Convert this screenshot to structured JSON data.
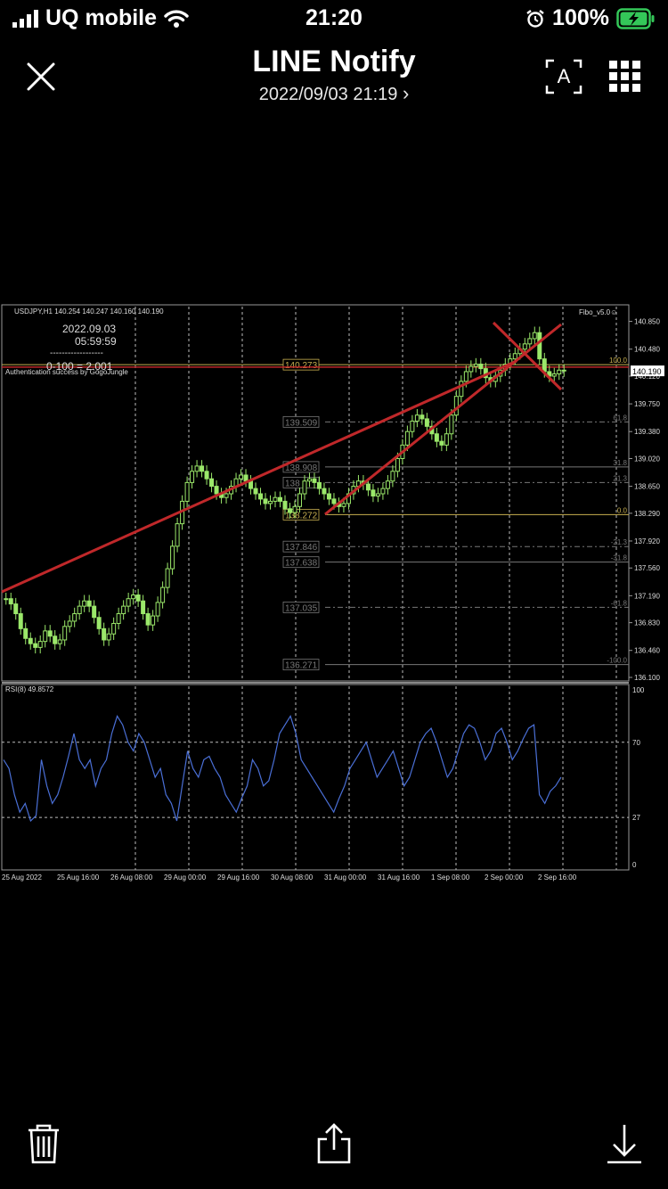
{
  "status_bar": {
    "carrier": "UQ mobile",
    "time": "21:20",
    "battery": "100%"
  },
  "header": {
    "title": "LINE Notify",
    "subtitle": "2022/09/03 21:19",
    "chevron": "›",
    "translate_label": "A"
  },
  "icons": {
    "close": "close-icon",
    "translate": "live-text-icon",
    "grid": "grid-icon",
    "delete": "trash-icon",
    "share": "share-icon",
    "save": "download-icon"
  },
  "chart_data": {
    "type": "line",
    "symbol_header": "USDJPY,H1  140.254 140.247 140.160 140.190",
    "indicator_name": "Fibo_v5.0☺",
    "overlay": {
      "date": "2022.09.03",
      "time": "05:59:59",
      "dashes": "------------------",
      "calc": "0-100 = 2.001",
      "auth": "Authentication success   by GogoJungle"
    },
    "ylim": [
      136.1,
      141.0
    ],
    "price_axis": [
      "140.850",
      "140.480",
      "140.120",
      "139.750",
      "139.380",
      "139.020",
      "138.650",
      "138.290",
      "137.920",
      "137.560",
      "137.190",
      "136.830",
      "136.460",
      "136.100"
    ],
    "price_axis_values": [
      140.85,
      140.48,
      140.12,
      139.75,
      139.38,
      139.02,
      138.65,
      138.29,
      137.92,
      137.56,
      137.19,
      136.83,
      136.46,
      136.1
    ],
    "current_price": "140.190",
    "fib_levels": [
      {
        "pct": "100.0",
        "price": "140.273",
        "value": 140.273,
        "color": "#c8b050"
      },
      {
        "pct": "61.8",
        "price": "139.509",
        "value": 139.509,
        "color": "#777"
      },
      {
        "pct": "31.8",
        "price": "138.908",
        "value": 138.908,
        "color": "#777"
      },
      {
        "pct": "21.3",
        "price": "138",
        "value": 138.7,
        "color": "#777"
      },
      {
        "pct": "0.0",
        "price": "138.272",
        "value": 138.272,
        "color": "#c8b050"
      },
      {
        "pct": "-21.3",
        "price": "137.846",
        "value": 137.846,
        "color": "#777"
      },
      {
        "pct": "-31.8",
        "price": "137.638",
        "value": 137.638,
        "color": "#777"
      },
      {
        "pct": "-61.8",
        "price": "137.035",
        "value": 137.035,
        "color": "#777"
      },
      {
        "pct": "-100.0",
        "price": "136.271",
        "value": 136.271,
        "color": "#777"
      }
    ],
    "close_series": [
      137.15,
      137.08,
      136.95,
      136.75,
      136.62,
      136.55,
      136.5,
      136.58,
      136.72,
      136.65,
      136.55,
      136.6,
      136.78,
      136.85,
      136.95,
      137.05,
      137.12,
      137.05,
      136.9,
      136.75,
      136.6,
      136.68,
      136.82,
      136.95,
      137.05,
      137.15,
      137.2,
      137.12,
      136.95,
      136.8,
      136.92,
      137.1,
      137.3,
      137.55,
      137.85,
      138.15,
      138.45,
      138.7,
      138.85,
      138.92,
      138.85,
      138.75,
      138.65,
      138.55,
      138.5,
      138.55,
      138.65,
      138.75,
      138.8,
      138.72,
      138.62,
      138.55,
      138.48,
      138.42,
      138.45,
      138.5,
      138.45,
      138.35,
      138.3,
      138.38,
      138.55,
      138.72,
      138.75,
      138.7,
      138.62,
      138.55,
      138.48,
      138.42,
      138.38,
      138.42,
      138.55,
      138.65,
      138.72,
      138.68,
      138.6,
      138.52,
      138.55,
      138.62,
      138.72,
      138.85,
      139.02,
      139.2,
      139.38,
      139.52,
      139.6,
      139.55,
      139.45,
      139.35,
      139.25,
      139.2,
      139.35,
      139.6,
      139.85,
      140.05,
      140.18,
      140.25,
      140.28,
      140.22,
      140.1,
      140.05,
      140.12,
      140.2,
      140.28,
      140.35,
      140.42,
      140.48,
      140.55,
      140.62,
      140.7,
      140.35,
      140.18,
      140.12,
      140.15,
      140.2,
      140.19
    ],
    "rsi_label": "RSI(8) 49.8572",
    "rsi_levels": [
      "100",
      "70",
      "27",
      "0"
    ],
    "rsi_values": [
      60,
      55,
      40,
      30,
      35,
      25,
      28,
      60,
      45,
      35,
      40,
      50,
      62,
      75,
      60,
      55,
      60,
      45,
      55,
      60,
      75,
      85,
      80,
      70,
      65,
      75,
      70,
      60,
      50,
      55,
      40,
      35,
      25,
      45,
      65,
      55,
      50,
      60,
      62,
      55,
      50,
      40,
      35,
      30,
      38,
      45,
      60,
      55,
      45,
      48,
      60,
      75,
      80,
      85,
      75,
      60,
      55,
      50,
      45,
      40,
      35,
      30,
      38,
      45,
      55,
      60,
      65,
      70,
      60,
      50,
      55,
      60,
      65,
      55,
      45,
      50,
      60,
      70,
      75,
      78,
      70,
      60,
      50,
      55,
      65,
      75,
      80,
      78,
      70,
      60,
      65,
      75,
      78,
      70,
      60,
      65,
      72,
      78,
      80,
      40,
      35,
      42,
      45,
      50
    ],
    "time_axis": [
      "25 Aug 2022",
      "25 Aug 16:00",
      "26 Aug 08:00",
      "29 Aug 00:00",
      "29 Aug 16:00",
      "30 Aug 08:00",
      "31 Aug 00:00",
      "31 Aug 16:00",
      "1 Sep 08:00",
      "2 Sep 00:00",
      "2 Sep 16:00"
    ]
  }
}
